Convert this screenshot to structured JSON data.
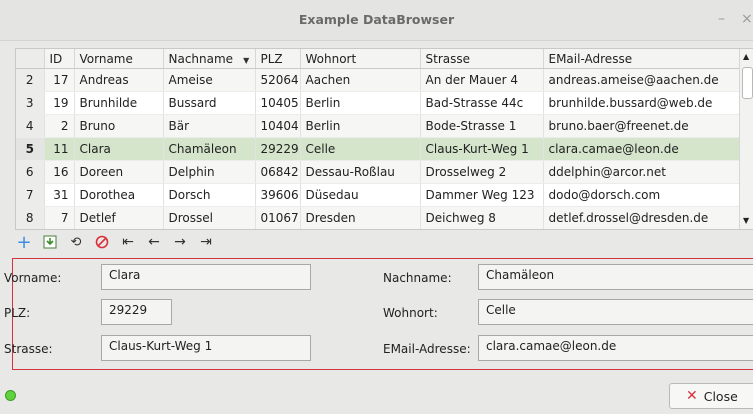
{
  "window": {
    "title": "Example DataBrowser",
    "minimize": "–",
    "close": "×"
  },
  "table": {
    "columns": [
      "",
      "ID",
      "Vorname",
      "Nachname",
      "PLZ",
      "Wohnort",
      "Strasse",
      "EMail-Adresse"
    ],
    "rows": [
      {
        "n": "2",
        "id": "17",
        "vorname": "Andreas",
        "nachname": "Ameise",
        "plz": "52064",
        "wohnort": "Aachen",
        "strasse": "An der Mauer 4",
        "email": "andreas.ameise@aachen.de"
      },
      {
        "n": "3",
        "id": "19",
        "vorname": "Brunhilde",
        "nachname": "Bussard",
        "plz": "10405",
        "wohnort": "Berlin",
        "strasse": "Bad-Strasse 44c",
        "email": "brunhilde.bussard@web.de"
      },
      {
        "n": "4",
        "id": "2",
        "vorname": "Bruno",
        "nachname": "Bär",
        "plz": "10404",
        "wohnort": "Berlin",
        "strasse": "Bode-Strasse 1",
        "email": "bruno.baer@freenet.de"
      },
      {
        "n": "5",
        "id": "11",
        "vorname": "Clara",
        "nachname": "Chamäleon",
        "plz": "29229",
        "wohnort": "Celle",
        "strasse": "Claus-Kurt-Weg 1",
        "email": "clara.camae@leon.de"
      },
      {
        "n": "6",
        "id": "16",
        "vorname": "Doreen",
        "nachname": "Delphin",
        "plz": "06842",
        "wohnort": "Dessau-Roßlau",
        "strasse": "Drosselweg 2",
        "email": "ddelphin@arcor.net"
      },
      {
        "n": "7",
        "id": "31",
        "vorname": "Dorothea",
        "nachname": "Dorsch",
        "plz": "39606",
        "wohnort": "Düsedau",
        "strasse": "Dammer Weg 123",
        "email": "dodo@dorsch.com"
      },
      {
        "n": "8",
        "id": "7",
        "vorname": "Detlef",
        "nachname": "Drossel",
        "plz": "01067",
        "wohnort": "Dresden",
        "strasse": "Deichweg 8",
        "email": "detlef.drossel@dresden.de"
      }
    ],
    "selected_row": "5"
  },
  "toolbar": {
    "icons": [
      "plus-icon",
      "save-icon",
      "refresh-icon",
      "delete-icon",
      "first-icon",
      "prev-icon",
      "next-icon",
      "last-icon"
    ]
  },
  "form": {
    "vorname_label": "Vorname:",
    "vorname_value": "Clara",
    "nachname_label": "Nachname:",
    "nachname_value": "Chamäleon",
    "plz_label": "PLZ:",
    "plz_value": "29229",
    "wohnort_label": "Wohnort:",
    "wohnort_value": "Celle",
    "strasse_label": "Strasse:",
    "strasse_value": "Claus-Kurt-Weg 1",
    "email_label": "EMail-Adresse:",
    "email_value": "clara.camae@leon.de"
  },
  "footer": {
    "close_label": "Close",
    "status_color": "#5fd33e"
  },
  "colors": {
    "selected_row": "#d5e5cc",
    "form_border": "#d2333f",
    "accent_blue": "#3d8ee0"
  }
}
